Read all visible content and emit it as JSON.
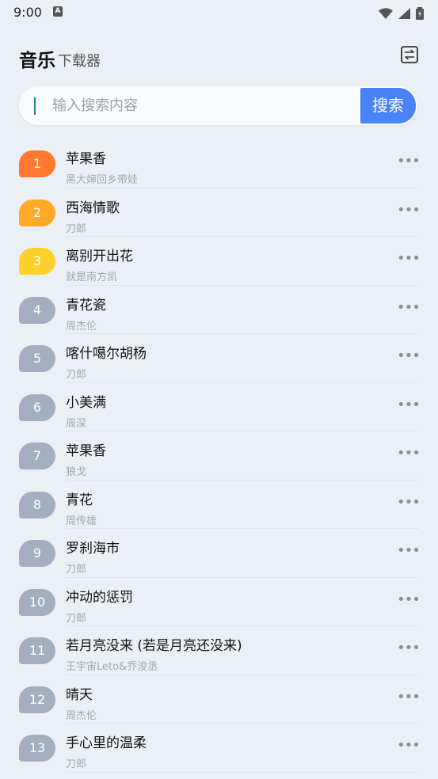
{
  "status_bar": {
    "time": "9:00",
    "notification_letter": "A"
  },
  "header": {
    "title": "音乐",
    "subtitle": "下载器"
  },
  "search": {
    "placeholder": "输入搜索内容",
    "value": "",
    "button_label": "搜索"
  },
  "colors": {
    "background": "#eaf0f5",
    "accent": "#4a82f7",
    "rank_1": "#ff7a2e",
    "rank_2": "#ffa929",
    "rank_3": "#ffcf2a",
    "rank_other": "#a3afc1"
  },
  "songs": [
    {
      "rank": "1",
      "title": "苹果香",
      "artist": "黑大婶回乡带娃"
    },
    {
      "rank": "2",
      "title": "西海情歌",
      "artist": "刀郎"
    },
    {
      "rank": "3",
      "title": "离别开出花",
      "artist": "就是南方凯"
    },
    {
      "rank": "4",
      "title": "青花瓷",
      "artist": "周杰伦"
    },
    {
      "rank": "5",
      "title": "喀什噶尔胡杨",
      "artist": "刀郎"
    },
    {
      "rank": "6",
      "title": "小美满",
      "artist": "周深"
    },
    {
      "rank": "7",
      "title": "苹果香",
      "artist": "狼戈"
    },
    {
      "rank": "8",
      "title": "青花",
      "artist": "周传雄"
    },
    {
      "rank": "9",
      "title": "罗刹海市",
      "artist": "刀郎"
    },
    {
      "rank": "10",
      "title": "冲动的惩罚",
      "artist": "刀郎"
    },
    {
      "rank": "11",
      "title": "若月亮没来 (若是月亮还没来)",
      "artist": "王宇宙Leto&乔浚丞"
    },
    {
      "rank": "12",
      "title": "晴天",
      "artist": "周杰伦"
    },
    {
      "rank": "13",
      "title": "手心里的温柔",
      "artist": "刀郎"
    }
  ],
  "more_icon": "more-horizontal-icon"
}
